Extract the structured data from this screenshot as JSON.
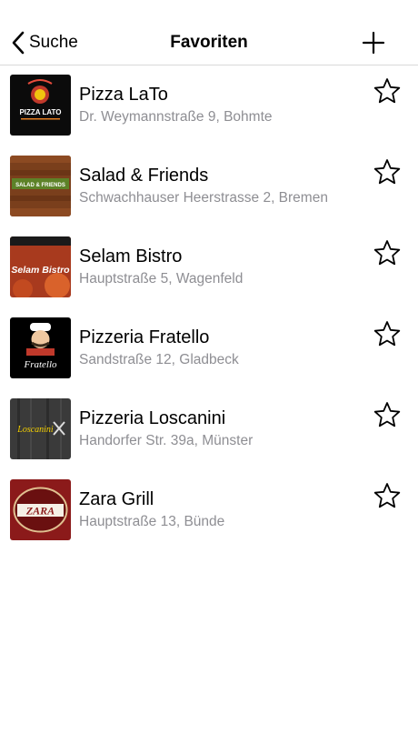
{
  "navbar": {
    "back_label": "Suche",
    "title": "Favoriten",
    "back_icon": "chevron-left-icon",
    "add_icon": "plus-icon"
  },
  "favorites": [
    {
      "name": "Pizza LaTo",
      "address": "Dr. Weymannstraße 9, Bohmte",
      "logo_text": "PIZZA LATO"
    },
    {
      "name": "Salad & Friends",
      "address": "Schwachhauser Heerstrasse 2, Bremen",
      "logo_text": "SALAD & FRIENDS"
    },
    {
      "name": "Selam Bistro",
      "address": "Hauptstraße 5, Wagenfeld",
      "logo_text": "Selam Bistro"
    },
    {
      "name": "Pizzeria Fratello",
      "address": "Sandstraße 12, Gladbeck",
      "logo_text": "Fratello"
    },
    {
      "name": "Pizzeria Loscanini",
      "address": "Handorfer Str. 39a, Münster",
      "logo_text": "Loscanini"
    },
    {
      "name": "Zara Grill",
      "address": "Hauptstraße 13, Bünde",
      "logo_text": "ZARA"
    }
  ],
  "colors": {
    "secondary_text": "#8e8e93",
    "separator": "#d8d8d8"
  }
}
